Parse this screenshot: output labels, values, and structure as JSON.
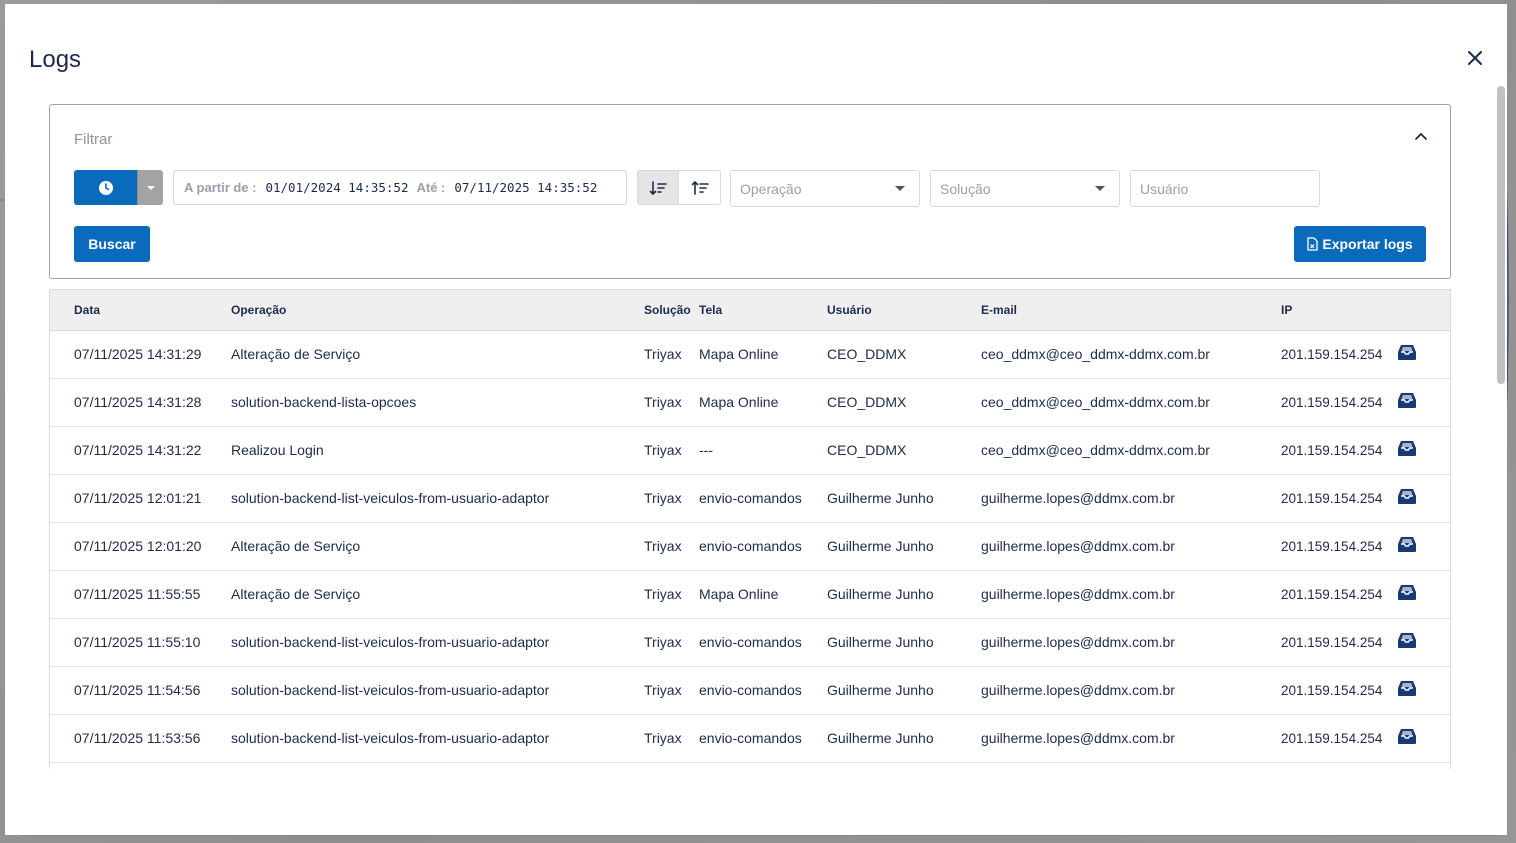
{
  "modal": {
    "title": "Logs"
  },
  "filter": {
    "title": "Filtrar",
    "date_from_label": "A partir de :",
    "date_from_value": "01/01/2024 14:35:52",
    "date_to_label": "Até :",
    "date_to_value": "07/11/2025 14:35:52",
    "operation_placeholder": "Operação",
    "solution_placeholder": "Solução",
    "user_placeholder": "Usuário",
    "search_label": "Buscar",
    "export_label": "Exportar logs"
  },
  "colors": {
    "primary": "#0a6bbd",
    "text": "#1d2b4a",
    "header_bg": "#efefef"
  },
  "table": {
    "columns": [
      "Data",
      "Operação",
      "Solução",
      "Tela",
      "Usuário",
      "E-mail",
      "IP"
    ],
    "rows": [
      [
        "07/11/2025 14:31:29",
        "Alteração de Serviço",
        "Triyax",
        "Mapa Online",
        "CEO_DDMX",
        "ceo_ddmx@ceo_ddmx-ddmx.com.br",
        "201.159.154.254"
      ],
      [
        "07/11/2025 14:31:28",
        "solution-backend-lista-opcoes",
        "Triyax",
        "Mapa Online",
        "CEO_DDMX",
        "ceo_ddmx@ceo_ddmx-ddmx.com.br",
        "201.159.154.254"
      ],
      [
        "07/11/2025 14:31:22",
        "Realizou Login",
        "Triyax",
        "---",
        "CEO_DDMX",
        "ceo_ddmx@ceo_ddmx-ddmx.com.br",
        "201.159.154.254"
      ],
      [
        "07/11/2025 12:01:21",
        "solution-backend-list-veiculos-from-usuario-adaptor",
        "Triyax",
        "envio-comandos",
        "Guilherme Junho",
        "guilherme.lopes@ddmx.com.br",
        "201.159.154.254"
      ],
      [
        "07/11/2025 12:01:20",
        "Alteração de Serviço",
        "Triyax",
        "envio-comandos",
        "Guilherme Junho",
        "guilherme.lopes@ddmx.com.br",
        "201.159.154.254"
      ],
      [
        "07/11/2025 11:55:55",
        "Alteração de Serviço",
        "Triyax",
        "Mapa Online",
        "Guilherme Junho",
        "guilherme.lopes@ddmx.com.br",
        "201.159.154.254"
      ],
      [
        "07/11/2025 11:55:10",
        "solution-backend-list-veiculos-from-usuario-adaptor",
        "Triyax",
        "envio-comandos",
        "Guilherme Junho",
        "guilherme.lopes@ddmx.com.br",
        "201.159.154.254"
      ],
      [
        "07/11/2025 11:54:56",
        "solution-backend-list-veiculos-from-usuario-adaptor",
        "Triyax",
        "envio-comandos",
        "Guilherme Junho",
        "guilherme.lopes@ddmx.com.br",
        "201.159.154.254"
      ],
      [
        "07/11/2025 11:53:56",
        "solution-backend-list-veiculos-from-usuario-adaptor",
        "Triyax",
        "envio-comandos",
        "Guilherme Junho",
        "guilherme.lopes@ddmx.com.br",
        "201.159.154.254"
      ]
    ],
    "row_action_icon": "inbox-tray-icon"
  }
}
